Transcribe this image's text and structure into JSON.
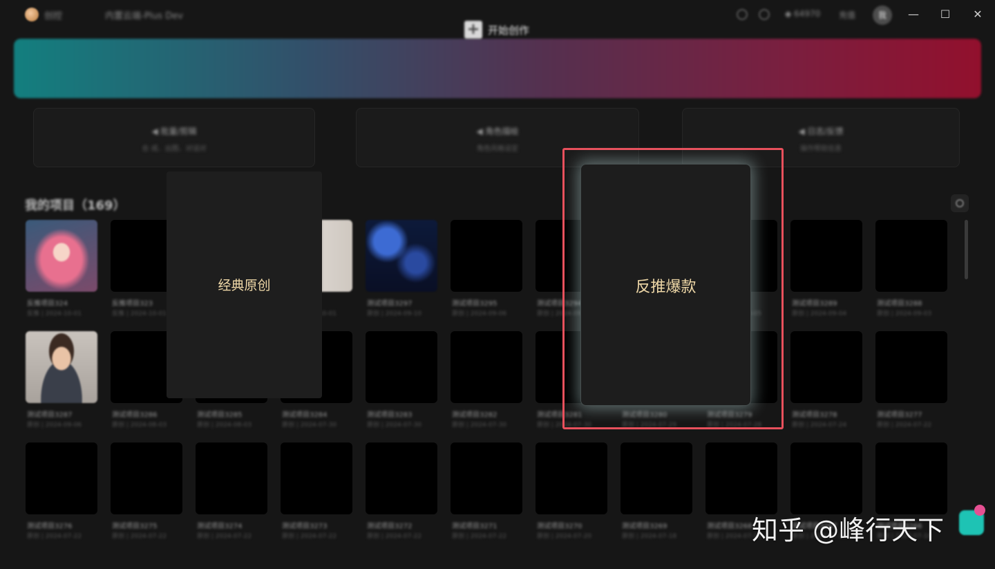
{
  "titlebar": {
    "app_name": "创控",
    "version_name": "内置云端-Plus Dev",
    "points": "◆ 64970",
    "recharge": "充值",
    "avatar_text": "我",
    "minimize": "—",
    "maximize": "☐",
    "close": "✕"
  },
  "banner": {
    "label": "开始创作",
    "plus": "+"
  },
  "quick_cards": [
    {
      "title": "◀ 批量/剪辑",
      "subtitle": "合 成、出图、对话对"
    },
    {
      "title": "◀ 角色描绘",
      "subtitle": "角色风格设定"
    },
    {
      "title": "◀ 日志/反馈",
      "subtitle": "操作帮助信息"
    }
  ],
  "projects": {
    "title": "我的项目（169）",
    "rows": [
      [
        {
          "name": "反推项目324",
          "meta": "反推 | 2024-10-01",
          "thumb": "anime"
        },
        {
          "name": "反推项目323",
          "meta": "反推 | 2024-10-01",
          "thumb": "dark"
        },
        {
          "name": "",
          "meta": "",
          "thumb": "dark"
        },
        {
          "name": "项目3",
          "meta": "原创 | 2024-10-01",
          "thumb": "light"
        },
        {
          "name": "测试项目3297",
          "meta": "原创 | 2024-09-10",
          "thumb": "night"
        },
        {
          "name": "测试项目3295",
          "meta": "原创 | 2024-09-06",
          "thumb": "dark"
        },
        {
          "name": "测试项目3294",
          "meta": "原创 | 2024-09-05",
          "thumb": "dark"
        },
        {
          "name": "",
          "meta": "",
          "thumb": "dark"
        },
        {
          "name": "项目3290",
          "meta": "原创 | 2024-09-05",
          "thumb": "dark"
        },
        {
          "name": "测试项目3289",
          "meta": "原创 | 2024-09-04",
          "thumb": "dark"
        },
        {
          "name": "测试项目3288",
          "meta": "原创 | 2024-09-03",
          "thumb": "dark"
        }
      ],
      [
        {
          "name": "测试项目3287",
          "meta": "原创 | 2024-09-06",
          "thumb": "boy"
        },
        {
          "name": "测试项目3286",
          "meta": "原创 | 2024-08-03",
          "thumb": "dark"
        },
        {
          "name": "测试项目3285",
          "meta": "原创 | 2024-08-03",
          "thumb": "dark"
        },
        {
          "name": "测试项目3284",
          "meta": "原创 | 2024-07-30",
          "thumb": "dark"
        },
        {
          "name": "测试项目3283",
          "meta": "原创 | 2024-07-30",
          "thumb": "dark"
        },
        {
          "name": "测试项目3282",
          "meta": "原创 | 2024-07-30",
          "thumb": "dark"
        },
        {
          "name": "测试项目3281",
          "meta": "原创 | 2024-07-30",
          "thumb": "dark"
        },
        {
          "name": "测试项目3280",
          "meta": "原创 | 2024-07-29",
          "thumb": "dark"
        },
        {
          "name": "测试项目3279",
          "meta": "原创 | 2024-07-28",
          "thumb": "dark"
        },
        {
          "name": "测试项目3278",
          "meta": "原创 | 2024-07-24",
          "thumb": "dark"
        },
        {
          "name": "测试项目3277",
          "meta": "原创 | 2024-07-22",
          "thumb": "dark"
        }
      ],
      [
        {
          "name": "测试项目3276",
          "meta": "原创 | 2024-07-22",
          "thumb": "dark"
        },
        {
          "name": "测试项目3275",
          "meta": "原创 | 2024-07-22",
          "thumb": "dark"
        },
        {
          "name": "测试项目3274",
          "meta": "原创 | 2024-07-22",
          "thumb": "dark"
        },
        {
          "name": "测试项目3273",
          "meta": "原创 | 2024-07-22",
          "thumb": "dark"
        },
        {
          "name": "测试项目3272",
          "meta": "原创 | 2024-07-22",
          "thumb": "dark"
        },
        {
          "name": "测试项目3271",
          "meta": "原创 | 2024-07-22",
          "thumb": "dark"
        },
        {
          "name": "测试项目3270",
          "meta": "原创 | 2024-07-20",
          "thumb": "dark"
        },
        {
          "name": "测试项目3269",
          "meta": "原创 | 2024-07-18",
          "thumb": "dark"
        },
        {
          "name": "测试项目3268",
          "meta": "原创 | 2024-07-18",
          "thumb": "dark"
        },
        {
          "name": "测试项目3267",
          "meta": "原创 | 2024-07-18",
          "thumb": "dark"
        },
        {
          "name": "测试项目3266",
          "meta": "原创 | 2024-07-18",
          "thumb": "dark"
        }
      ]
    ]
  },
  "mode_cards": {
    "classic": "经典原创",
    "reverse": "反推爆款"
  },
  "watermark": "知乎 @峰行天下",
  "colors": {
    "background": "#161616",
    "banner_start": "#137f7f",
    "banner_end": "#92102d",
    "highlight": "#e8505c",
    "mode_label": "#f0d9a8"
  }
}
